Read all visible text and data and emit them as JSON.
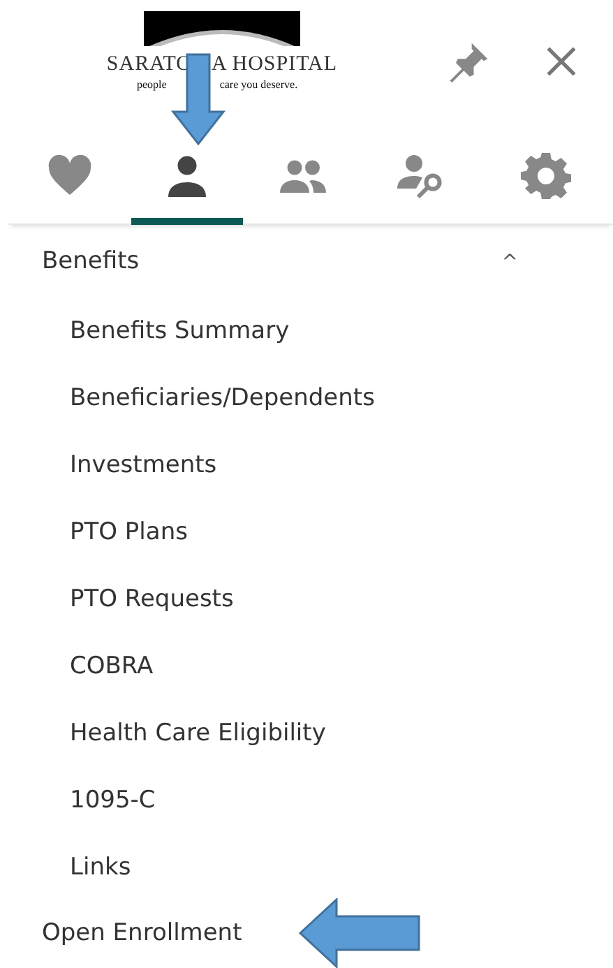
{
  "logo": {
    "name_parts": [
      "SARATO",
      "A HOSPITAL"
    ],
    "tagline_parts": [
      "people",
      "care you deserve."
    ]
  },
  "tabs": [
    {
      "kind": "heart",
      "selected": false
    },
    {
      "kind": "person",
      "selected": true
    },
    {
      "kind": "people",
      "selected": false
    },
    {
      "kind": "person-key",
      "selected": false
    },
    {
      "kind": "gear",
      "selected": false
    }
  ],
  "menu": {
    "section": "Benefits",
    "expanded": true,
    "toggle": "^",
    "items": [
      "Benefits Summary",
      "Beneficiaries/Dependents",
      "Investments",
      "PTO Plans",
      "PTO Requests",
      "COBRA",
      "Health Care Eligibility",
      "1095-C",
      "Links"
    ]
  },
  "footer_item": "Open Enrollment",
  "annotations": [
    {
      "kind": "down"
    },
    {
      "kind": "left"
    }
  ]
}
